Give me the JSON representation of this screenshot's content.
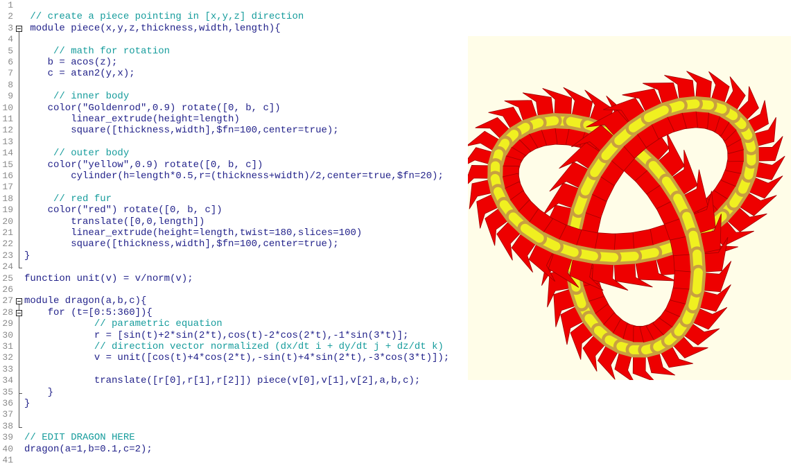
{
  "editor": {
    "lines": [
      "",
      " // create a piece pointing in [x,y,z] direction",
      " module piece(x,y,z,thickness,width,length){",
      "",
      "     // math for rotation",
      "    b = acos(z);",
      "    c = atan2(y,x);",
      "",
      "     // inner body",
      "    color(\"Goldenrod\",0.9) rotate([0, b, c])",
      "        linear_extrude(height=length)",
      "        square([thickness,width],$fn=100,center=true);",
      "",
      "     // outer body",
      "    color(\"yellow\",0.9) rotate([0, b, c])",
      "        cylinder(h=length*0.5,r=(thickness+width)/2,center=true,$fn=20);",
      "",
      "     // red fur",
      "    color(\"red\") rotate([0, b, c])",
      "        translate([0,0,length])",
      "        linear_extrude(height=length,twist=180,slices=100)",
      "        square([thickness,width],$fn=100,center=true);",
      "}",
      "",
      "function unit(v) = v/norm(v);",
      "",
      "module dragon(a,b,c){",
      "    for (t=[0:5:360]){",
      "            // parametric equation",
      "            r = [sin(t)+2*sin(2*t),cos(t)-2*cos(2*t),-1*sin(3*t)];",
      "            // direction vector normalized (dx/dt i + dy/dt j + dz/dt k)",
      "            v = unit([cos(t)+4*cos(2*t),-sin(t)+4*sin(2*t),-3*cos(3*t)]);",
      "",
      "            translate([r[0],r[1],r[2]]) piece(v[0],v[1],v[2],a,b,c);",
      "    }",
      "}",
      "",
      "",
      "// EDIT DRAGON HERE",
      "dragon(a=1,b=0.1,c=2);",
      ""
    ],
    "fold_markers": [
      3,
      27,
      28
    ]
  },
  "viewer": {
    "background": "#fffde8",
    "fur_color": "#ee0000",
    "body_color": "#f0f020",
    "inner_color": "#c8a040"
  }
}
